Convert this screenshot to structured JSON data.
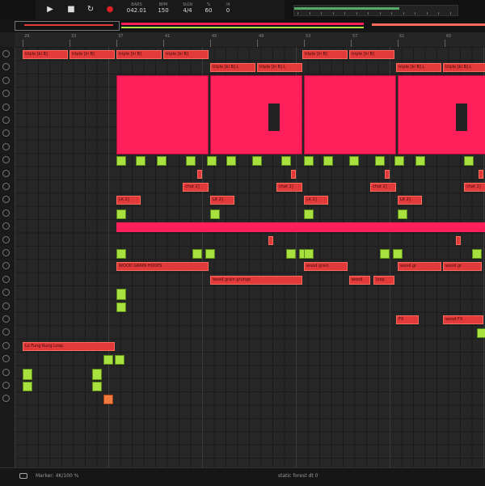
{
  "transport": {
    "play_icon": "play-icon",
    "stop_icon": "stop-icon",
    "loop_icon": "loop-icon",
    "record_icon": "record-icon",
    "colors": {
      "record": "#e02020"
    },
    "stats": [
      {
        "label": "BARS",
        "value": "042.01"
      },
      {
        "label": "BPM",
        "value": "150"
      },
      {
        "label": "SIGN",
        "value": "4/4"
      },
      {
        "label": "%",
        "value": "60"
      },
      {
        "label": "/4",
        "value": "0"
      }
    ]
  },
  "ruler": {
    "labels": [
      "29",
      "33",
      "37",
      "41",
      "45",
      "49",
      "53",
      "57",
      "61",
      "65"
    ]
  },
  "clips": {
    "top": [
      "triple [ki B]",
      "triple [ki B]",
      "triple [ki B]",
      "triple [ki B]",
      "triple [ki B]",
      "triple [ki B]",
      "triple [ki B]"
    ],
    "second": [
      "triple [ki B] L",
      "triple [ki B] L",
      "triple [ki B] L",
      "triple [ki B] L"
    ],
    "chat": [
      "chat 2]",
      "chat 2]",
      "chat 2]",
      "chat 2]"
    ],
    "lk": [
      "LK 2]",
      "LK 2]",
      "LK 2]",
      "LK 2]"
    ],
    "wood1": [
      "WOOD GRAIN HOOPS",
      "wood grain",
      "wood gr",
      "wood gr"
    ],
    "wood2": [
      "wood grain grunge",
      "wood",
      "loop"
    ],
    "fx": [
      "FX",
      "wood FX",
      "wood FX"
    ],
    "left": "Lo Fung Kung Loop"
  },
  "colors": {
    "clip": "#e23a3a",
    "block": "#ff1f5a",
    "green": "#a8e040",
    "orange": "#f07a40"
  },
  "status": {
    "left": "Marker: 4K/100 %",
    "center": "static forest dt 0"
  }
}
